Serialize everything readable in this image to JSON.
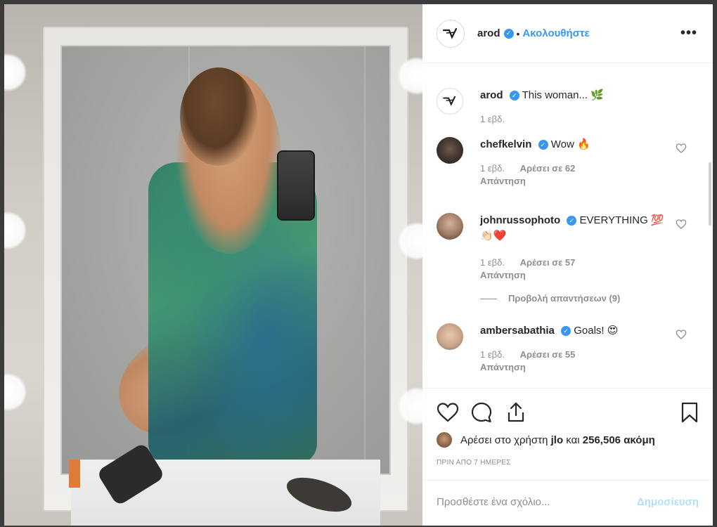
{
  "post": {
    "author": "arod",
    "follow_label": "Ακολουθήστε",
    "dot": "•",
    "more": "•••"
  },
  "comments": [
    {
      "user": "arod",
      "text": "This woman... 🌿",
      "time": "1 εβδ.",
      "likes": "",
      "reply": ""
    },
    {
      "user": "chefkelvin",
      "text": "Wow 🔥",
      "time": "1 εβδ.",
      "likes": "Αρέσει σε 62",
      "reply": "Απάντηση"
    },
    {
      "user": "johnrussophoto",
      "text": "EVERYTHING 💯👏🏻❤️",
      "time": "1 εβδ.",
      "likes": "Αρέσει σε 57",
      "reply": "Απάντηση"
    },
    {
      "user": "ambersabathia",
      "text": "Goals! 😍",
      "time": "1 εβδ.",
      "likes": "Αρέσει σε 55",
      "reply": "Απάντηση"
    }
  ],
  "view_replies": "Προβολή απαντήσεων (9)",
  "likes": {
    "prefix": "Αρέσει στο χρήστη",
    "user": "jlo",
    "middle": "και",
    "count": "256,506",
    "suffix": "ακόμη"
  },
  "posted": "ΠΡΙΝ ΑΠΟ 7 ΗΜΕΡΕΣ",
  "comment_box": {
    "placeholder": "Προσθέστε ένα σχόλιο...",
    "publish_label": "Δημοσίευση"
  },
  "colors": {
    "accent": "#3897f0",
    "publish_disabled": "#b2dffc",
    "muted": "#8e8e8e"
  },
  "icons": [
    "heart-icon",
    "comment-icon",
    "share-icon",
    "bookmark-icon",
    "verified-icon",
    "more-options-icon"
  ]
}
